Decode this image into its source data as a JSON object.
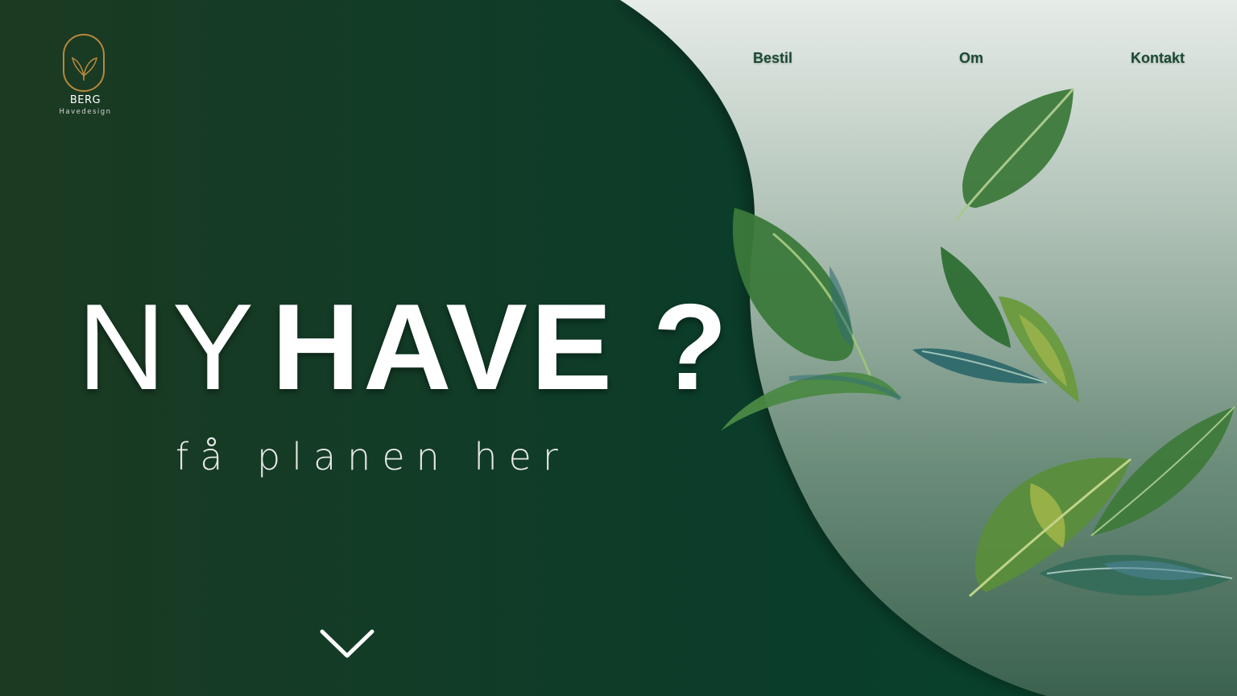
{
  "brand": {
    "name": "BERG",
    "tagline": "Havedesign",
    "accent_color": "#b8893d"
  },
  "nav": {
    "items": [
      {
        "label": "Bestil"
      },
      {
        "label": "Om"
      },
      {
        "label": "Kontakt"
      }
    ],
    "color": "#1a4a34"
  },
  "hero": {
    "title_light": "NY",
    "title_bold": "HAVE ?",
    "subtitle": "få planen her",
    "scroll_icon": "chevron-down-icon"
  },
  "colors": {
    "dark_green": "#0b3d2a",
    "panel_top": "#e6ece8",
    "panel_bottom": "#3f6a55"
  }
}
